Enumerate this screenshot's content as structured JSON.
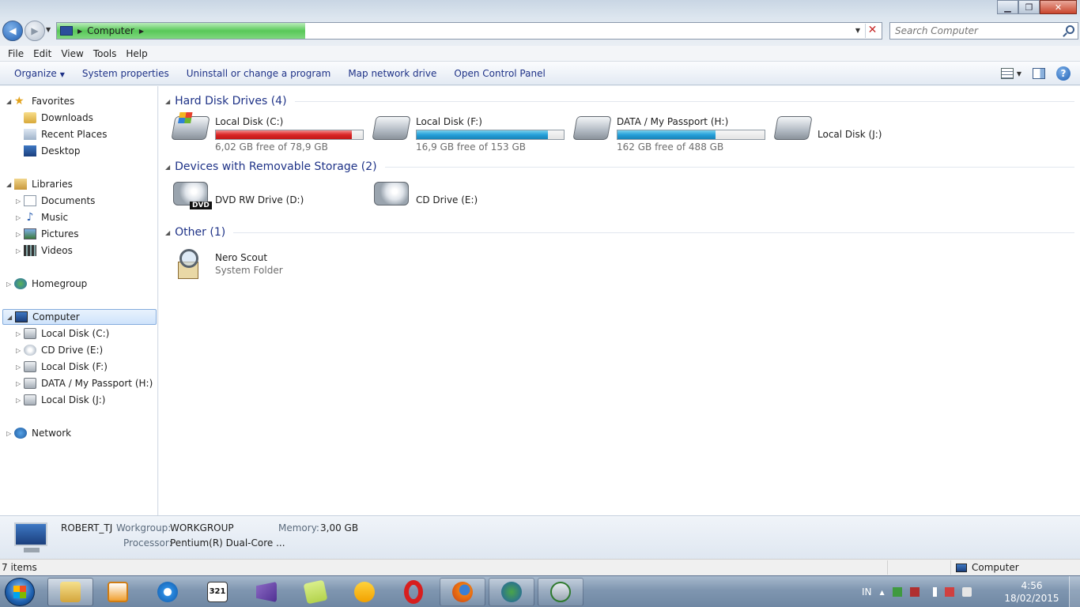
{
  "window": {
    "address_path": "Computer",
    "search_placeholder": "Search Computer",
    "controls": {
      "minimize": "▁",
      "maximize": "❐",
      "close": "✕"
    }
  },
  "menu": [
    "File",
    "Edit",
    "View",
    "Tools",
    "Help"
  ],
  "commands": {
    "organize": "Organize",
    "system_properties": "System properties",
    "uninstall": "Uninstall or change a program",
    "map_drive": "Map network drive",
    "control_panel": "Open Control Panel",
    "help": "?"
  },
  "nav": {
    "favorites": "Favorites",
    "downloads": "Downloads",
    "recent_places": "Recent Places",
    "desktop": "Desktop",
    "libraries": "Libraries",
    "documents": "Documents",
    "music": "Music",
    "pictures": "Pictures",
    "videos": "Videos",
    "homegroup": "Homegroup",
    "computer": "Computer",
    "drive_c": "Local Disk (C:)",
    "drive_e": "CD Drive (E:)",
    "drive_f": "Local Disk (F:)",
    "drive_h": "DATA / My Passport (H:)",
    "drive_j": "Local Disk (J:)",
    "network": "Network"
  },
  "groups": {
    "hdd": {
      "title": "Hard Disk Drives (4)",
      "drives": [
        {
          "name": "Local Disk (C:)",
          "free": "6,02 GB free of 78,9 GB",
          "used_fraction": 0.924,
          "color": "#da2626"
        },
        {
          "name": "Local Disk (F:)",
          "free": "16,9 GB free of 153 GB",
          "used_fraction": 0.89,
          "color": "#26a0da"
        },
        {
          "name": "DATA / My Passport (H:)",
          "free": "162 GB free of 488 GB",
          "used_fraction": 0.668,
          "color": "#26a0da"
        },
        {
          "name": "Local Disk (J:)"
        }
      ]
    },
    "removable": {
      "title": "Devices with Removable Storage (2)",
      "devices": [
        {
          "name": "DVD RW Drive (D:)",
          "badge": "DVD"
        },
        {
          "name": "CD Drive (E:)"
        }
      ]
    },
    "other": {
      "title": "Other (1)",
      "items": [
        {
          "name": "Nero Scout",
          "type": "System Folder"
        }
      ]
    }
  },
  "details": {
    "computer_name": "ROBERT_TJ",
    "workgroup_label": "Workgroup:",
    "workgroup": "WORKGROUP",
    "memory_label": "Memory:",
    "memory": "3,00 GB",
    "processor_label": "Processor:",
    "processor": "Pentium(R) Dual-Core ..."
  },
  "status": {
    "count": "7 items",
    "zone": "Computer"
  },
  "taskbar": {
    "calendar_text": "321",
    "tray_lang": "IN",
    "time": "4:56",
    "date": "18/02/2015"
  }
}
